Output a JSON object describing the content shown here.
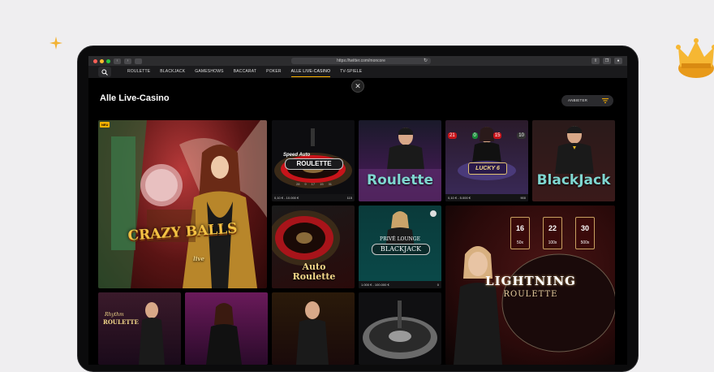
{
  "browser": {
    "url": "https://twitter.com/moncore"
  },
  "nav": {
    "items": [
      {
        "label": "ROULETTE",
        "active": false
      },
      {
        "label": "BLACKJACK",
        "active": false
      },
      {
        "label": "GAMESHOWS",
        "active": false
      },
      {
        "label": "BACCARAT",
        "active": false
      },
      {
        "label": "POKER",
        "active": false
      },
      {
        "label": "ALLE LIVE-CASINO",
        "active": true
      },
      {
        "label": "TV-SPIELE",
        "active": false
      }
    ]
  },
  "page": {
    "title": "Alle Live-Casino",
    "provider_label": "ANBIETER",
    "close_symbol": "✕"
  },
  "tiles": {
    "crazy_balls": {
      "badge": "NEU",
      "title": "CRAZY BALLS",
      "subtitle": "live"
    },
    "speed_auto_roulette": {
      "pre": "Speed Auto",
      "title": "ROULETTE",
      "limits": "0,10 € - 10.000 €",
      "players": "115",
      "numbers": [
        "28",
        "9",
        "17",
        "15",
        "31"
      ]
    },
    "roulette": {
      "title": "Roulette"
    },
    "lucky6": {
      "title": "LUCKY 6",
      "limits": "0,10 € - 5.000 €",
      "players": "900",
      "numbers": [
        "21",
        "0",
        "15",
        "10"
      ]
    },
    "blackjack": {
      "title": "BlackJack"
    },
    "auto_roulette": {
      "title": "Auto Roulette"
    },
    "prive_blackjack": {
      "pre": "PRIVÉ LOUNGE",
      "title": "BLACKJACK",
      "limits": "1.000 € - 100.000 €",
      "players": "0"
    },
    "lightning": {
      "title": "LIGHTNING",
      "subtitle": "ROULETTE",
      "numbers": [
        "16",
        "22",
        "30"
      ],
      "multipliers": [
        "50x",
        "100x",
        "500x"
      ]
    },
    "rhythm_roulette": {
      "pre": "Rhythm",
      "title": "ROULETTE"
    }
  },
  "colors": {
    "accent": "#ffb400",
    "teal_text": "#7fd6d0",
    "background": "#000000"
  }
}
